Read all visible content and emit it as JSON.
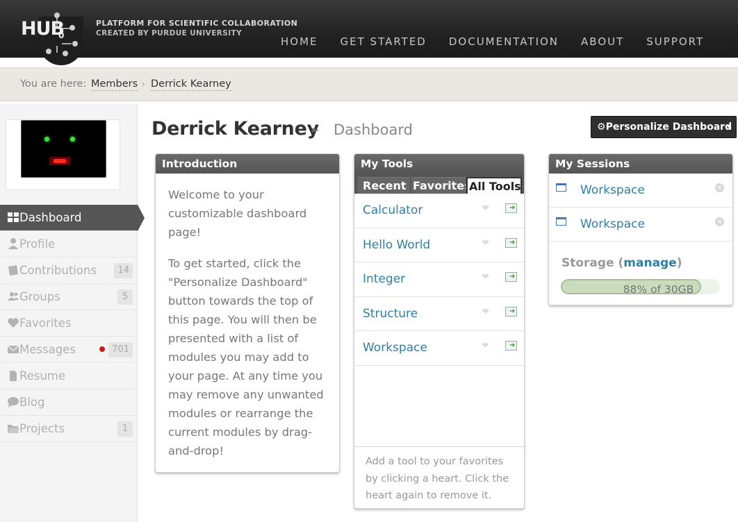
{
  "header": {
    "logo_text": "HUB",
    "logo_zero": "0",
    "tagline": "PLATFORM FOR SCIENTIFIC COLLABORATION",
    "tagline_sub": "CREATED BY PURDUE UNIVERSITY",
    "nav": [
      {
        "label": "HOME"
      },
      {
        "label": "GET STARTED"
      },
      {
        "label": "DOCUMENTATION"
      },
      {
        "label": "ABOUT"
      },
      {
        "label": "SUPPORT"
      }
    ]
  },
  "breadcrumb": {
    "prefix": "You are here:",
    "items": [
      "Members",
      "Derrick Kearney"
    ],
    "separator": "›"
  },
  "sidebar": {
    "items": [
      {
        "label": "Dashboard",
        "icon": "dashboard-icon",
        "active": true
      },
      {
        "label": "Profile",
        "icon": "user-icon"
      },
      {
        "label": "Contributions",
        "icon": "book-icon",
        "count": "14"
      },
      {
        "label": "Groups",
        "icon": "group-icon",
        "count": "5"
      },
      {
        "label": "Favorites",
        "icon": "heart-icon"
      },
      {
        "label": "Messages",
        "icon": "envelope-icon",
        "count": "701",
        "unread_dot": true
      },
      {
        "label": "Resume",
        "icon": "document-icon"
      },
      {
        "label": "Blog",
        "icon": "speech-bubble-icon"
      },
      {
        "label": "Projects",
        "icon": "folder-icon",
        "count": "1"
      }
    ]
  },
  "main": {
    "title": "Derrick Kearney",
    "title_arrow": "►",
    "subtitle": "Dashboard",
    "personalize_button": "Personalize Dashboard",
    "personalize_icon": "⚙",
    "dropdown_caret": "▾"
  },
  "intro": {
    "title": "Introduction",
    "paragraphs": [
      "Welcome to your customizable dashboard page!",
      "To get started, click the \"Personalize Dashboard\" button towards the top of this page. You will then be presented with a list of modules you may add to your page. At any time you may remove any unwanted modules or rearrange the current modules by drag-and-drop!"
    ]
  },
  "tools": {
    "title": "My Tools",
    "tabs": [
      "Recent",
      "Favorites",
      "All Tools"
    ],
    "active_tab": "All Tools",
    "items": [
      "Calculator",
      "Hello World",
      "Integer",
      "Structure",
      "Workspace"
    ],
    "hint": "Add a tool to your favorites by clicking a heart. Click the heart again to remove it."
  },
  "sessions": {
    "title": "My Sessions",
    "items": [
      "Workspace",
      "Workspace"
    ],
    "close_glyph": "×",
    "storage_label": "Storage (",
    "storage_link": "manage",
    "storage_close": ")",
    "storage_fraction": 0.88,
    "storage_text": "88% of 30GB"
  },
  "colors": {
    "link": "#2d7fa5",
    "header_bg": "#2a2a2a",
    "module_head": "#5e5e5e",
    "active_nav": "#555555",
    "unread_dot": "#cc1a1a",
    "storage_fill": "#c9dcbc"
  }
}
